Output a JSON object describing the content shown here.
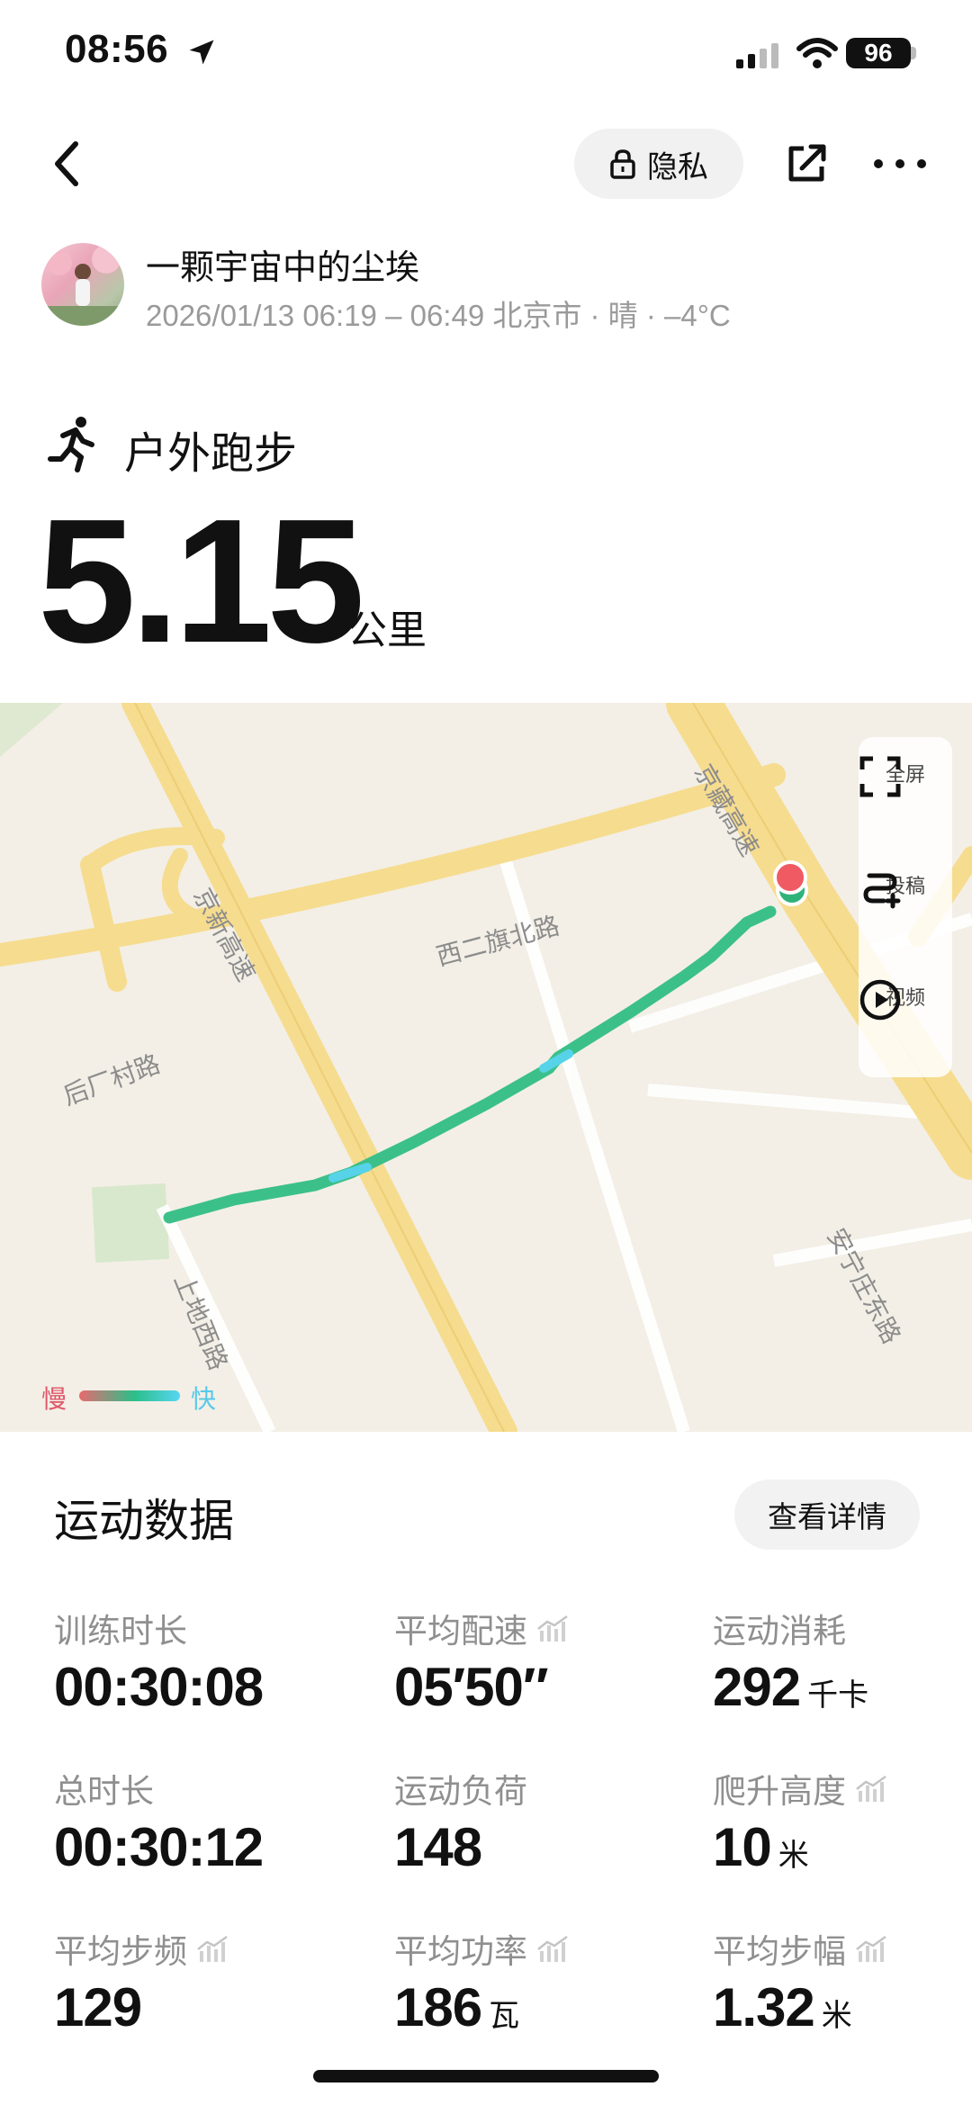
{
  "status_bar": {
    "time": "08:56",
    "battery": "96"
  },
  "header": {
    "privacy_label": "隐私"
  },
  "user": {
    "name": "一颗宇宙中的尘埃",
    "meta": "2026/01/13 06:19 – 06:49 北京市 · 晴 · –4°C"
  },
  "activity": {
    "type": "户外跑步",
    "distance": "5.15",
    "distance_unit": "公里"
  },
  "map": {
    "labels": {
      "jingzang": "京藏高速",
      "jingxin": "京新高速",
      "xierqi": "西二旗北路",
      "houchang": "后厂村路",
      "shangdi": "上地西路",
      "anning": "安宁庄东路"
    },
    "tools": {
      "fullscreen": "全屏",
      "submit": "投稿",
      "video": "视频"
    },
    "legend": {
      "slow": "慢",
      "fast": "快"
    },
    "colors": {
      "track": "#3cc08a",
      "start": "#2fb37a",
      "end": "#ef5a63",
      "road": "#f6dc8f"
    }
  },
  "stats": {
    "title": "运动数据",
    "detail_label": "查看详情",
    "items": [
      {
        "label": "训练时长",
        "value": "00:30:08",
        "unit": "",
        "trend": false
      },
      {
        "label": "平均配速",
        "value": "05′50″",
        "unit": "",
        "trend": true
      },
      {
        "label": "运动消耗",
        "value": "292",
        "unit": "千卡",
        "trend": false
      },
      {
        "label": "总时长",
        "value": "00:30:12",
        "unit": "",
        "trend": false
      },
      {
        "label": "运动负荷",
        "value": "148",
        "unit": "",
        "trend": false
      },
      {
        "label": "爬升高度",
        "value": "10",
        "unit": "米",
        "trend": true
      },
      {
        "label": "平均步频",
        "value": "129",
        "unit": "",
        "trend": true
      },
      {
        "label": "平均功率",
        "value": "186",
        "unit": "瓦",
        "trend": true
      },
      {
        "label": "平均步幅",
        "value": "1.32",
        "unit": "米",
        "trend": true
      }
    ]
  }
}
